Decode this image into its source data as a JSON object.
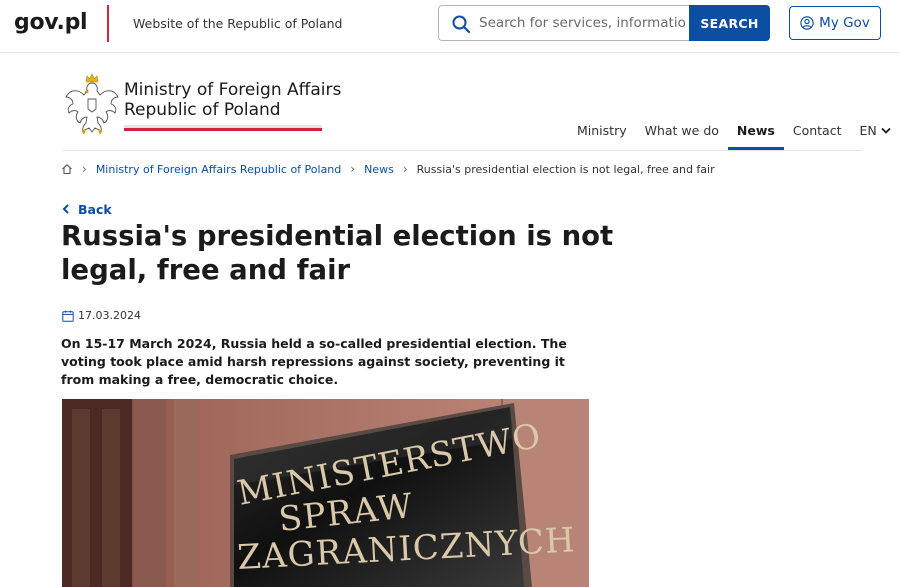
{
  "topbar": {
    "logo": "gov.pl",
    "caption": "Website of the Republic of Poland",
    "search_placeholder": "Search for services, information, news",
    "search_button": "SEARCH",
    "mygov_button": "My Gov"
  },
  "ministry": {
    "name_line1": "Ministry of Foreign Affairs",
    "name_line2": "Republic of Poland"
  },
  "nav": {
    "items": [
      {
        "label": "Ministry"
      },
      {
        "label": "What we do"
      },
      {
        "label": "News"
      },
      {
        "label": "Contact"
      },
      {
        "label": "EN"
      }
    ],
    "active": "News"
  },
  "breadcrumb": {
    "items": [
      {
        "label": "Ministry of Foreign Affairs Republic of Poland"
      },
      {
        "label": "News"
      },
      {
        "label": "Russia's presidential election is not legal, free and fair"
      }
    ]
  },
  "article": {
    "back_label": "Back",
    "title": "Russia's presidential election is not legal, free and fair",
    "date": "17.03.2024",
    "lead": "On 15-17 March 2024, Russia held a so-called presidential election. The voting took place amid harsh repressions against society, preventing it from making a free, democratic choice.",
    "image_plaque_lines": [
      "MINISTERSTWO",
      "SPRAW",
      "ZAGRANICZNYCH"
    ]
  },
  "colors": {
    "brand_blue": "#0b4ea2",
    "red": "#d4213d"
  }
}
